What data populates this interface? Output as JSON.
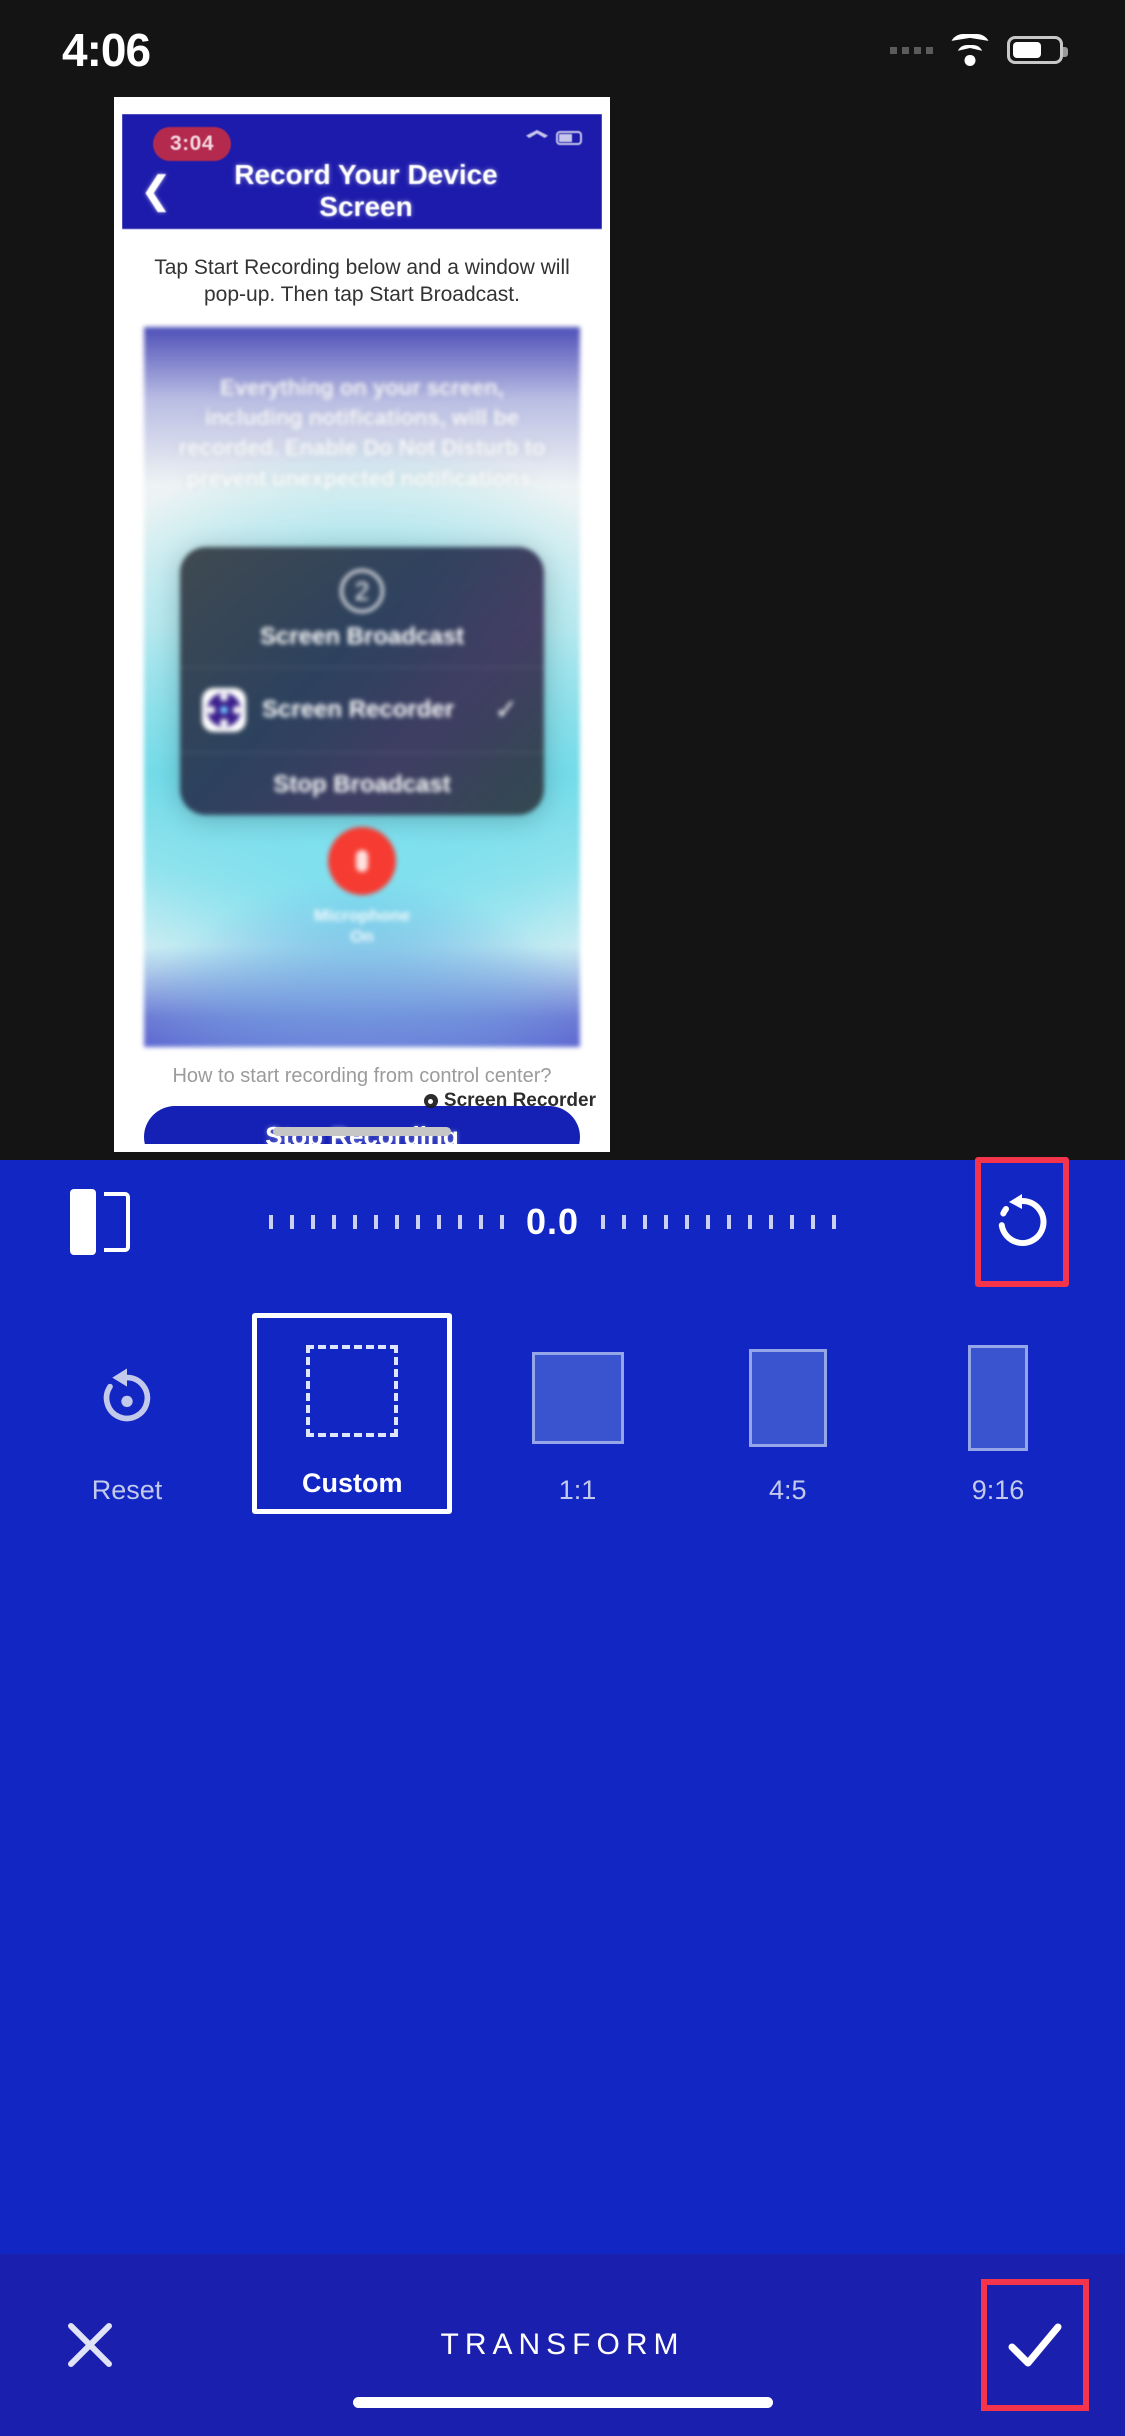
{
  "status_bar": {
    "time": "4:06",
    "icons": [
      "signal-dots-icon",
      "wifi-icon",
      "battery-icon"
    ],
    "battery_level_pct": 55
  },
  "canvas": {
    "screenshot": {
      "status_bar": {
        "recording_timer": "3:04",
        "icons": [
          "wifi-icon",
          "battery-charging-icon"
        ]
      },
      "header": {
        "back_icon": "chevron-left-icon",
        "title": "Record Your Device Screen",
        "background_color": "#1d1bab"
      },
      "instruction": "Tap Start Recording below and a window will pop-up. Then tap Start Broadcast.",
      "preview": {
        "notice": "Everything on your screen, including notifications, will be recorded. Enable Do Not Disturb to prevent unexpected notifications.",
        "dialog": {
          "step_badge": "2",
          "title": "Screen Broadcast",
          "app_row": {
            "icon": "screen-recorder-app-icon",
            "label": "Screen Recorder",
            "selected_icon": "check-icon"
          },
          "stop_label": "Stop Broadcast"
        },
        "microphone": {
          "icon": "microphone-icon",
          "color": "#f63b32",
          "label_line1": "Microphone",
          "label_line2": "On"
        }
      },
      "help_link": "How to start recording from control center?",
      "primary_button": {
        "label": "Stop Recording",
        "color": "#1521b5"
      },
      "watermark": "Screen Recorder"
    }
  },
  "editor": {
    "background_color": "#1226c4",
    "slider": {
      "flip_icon": "flip-horizontal-icon",
      "value": "0.0",
      "rotate_icon": "rotate-ccw-icon",
      "rotate_highlighted": true,
      "highlight_color": "#f4344a"
    },
    "aspect_ratios": [
      {
        "name": "reset",
        "label": "Reset",
        "icon": "reset-rotate-icon",
        "active": false
      },
      {
        "name": "custom",
        "label": "Custom",
        "icon": "custom-crop-icon",
        "active": true
      },
      {
        "name": "1_1",
        "label": "1:1",
        "icon": "square-icon",
        "active": false
      },
      {
        "name": "4_5",
        "label": "4:5",
        "icon": "portrait-4-5-icon",
        "active": false
      },
      {
        "name": "9_16",
        "label": "9:16",
        "icon": "portrait-9-16-icon",
        "active": false
      }
    ],
    "transform_bar": {
      "cancel_icon": "close-icon",
      "title": "TRANSFORM",
      "confirm_icon": "check-icon",
      "confirm_highlighted": true,
      "background_color": "#1a1fae"
    }
  }
}
